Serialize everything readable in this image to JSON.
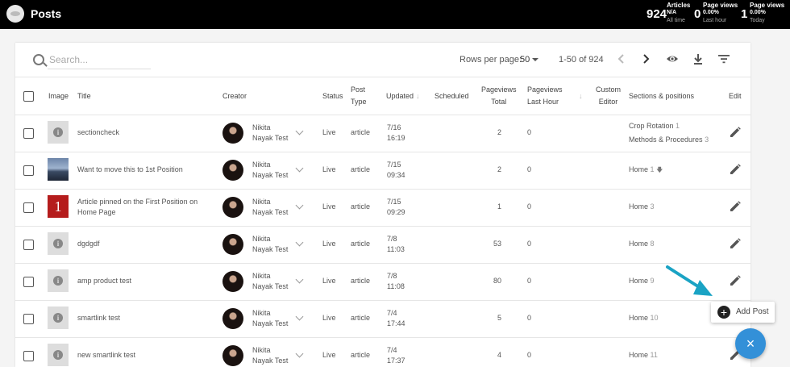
{
  "app": {
    "title": "Posts"
  },
  "stats": {
    "articles": {
      "label": "Articles",
      "value": "924",
      "sub_value": "N/A",
      "sub_label": "All time"
    },
    "pv_hour": {
      "label": "Page views",
      "value": "0",
      "sub_value": "0.00%",
      "sub_label": "Last hour"
    },
    "pv_today": {
      "label": "Page views",
      "value": "1",
      "sub_value": "0.00%",
      "sub_label": "Today"
    }
  },
  "toolbar": {
    "search_placeholder": "Search...",
    "rows_per_page_label": "Rows per page:",
    "rows_per_page_value": "50",
    "range": "1-50 of 924"
  },
  "columns": {
    "image": "Image",
    "title": "Title",
    "creator": "Creator",
    "status": "Status",
    "post_type_1": "Post",
    "post_type_2": "Type",
    "updated": "Updated",
    "scheduled": "Scheduled",
    "pv_total_1": "Pageviews",
    "pv_total_2": "Total",
    "pv_hour_1": "Pageviews",
    "pv_hour_2": "Last Hour",
    "custom_1": "Custom",
    "custom_2": "Editor",
    "sections": "Sections & positions",
    "edit": "Edit"
  },
  "rows": [
    {
      "title": "sectioncheck",
      "creator": "Nikita Nayak Test",
      "status": "Live",
      "type": "article",
      "updated_date": "7/16",
      "updated_time": "16:19",
      "pv_total": "2",
      "pv_hour": "0",
      "sections": [
        {
          "name": "Crop Rotation",
          "pos": "1"
        },
        {
          "name": "Methods & Procedures",
          "pos": "3"
        }
      ]
    },
    {
      "title": "Want to move this to 1st Position",
      "creator": "Nikita Nayak Test",
      "status": "Live",
      "type": "article",
      "updated_date": "7/15",
      "updated_time": "09:34",
      "pv_total": "2",
      "pv_hour": "0",
      "sections": [
        {
          "name": "Home",
          "pos": "1"
        }
      ]
    },
    {
      "title": "Article pinned on the First Position on Home Page",
      "creator": "Nikita Nayak Test",
      "status": "Live",
      "type": "article",
      "updated_date": "7/15",
      "updated_time": "09:29",
      "pv_total": "1",
      "pv_hour": "0",
      "thumb_text": "1",
      "sections": [
        {
          "name": "Home",
          "pos": "3"
        }
      ]
    },
    {
      "title": "dgdgdf",
      "creator": "Nikita Nayak Test",
      "status": "Live",
      "type": "article",
      "updated_date": "7/8",
      "updated_time": "11:03",
      "pv_total": "53",
      "pv_hour": "0",
      "sections": [
        {
          "name": "Home",
          "pos": "8"
        }
      ]
    },
    {
      "title": "amp product test",
      "creator": "Nikita Nayak Test",
      "status": "Live",
      "type": "article",
      "updated_date": "7/8",
      "updated_time": "11:08",
      "pv_total": "80",
      "pv_hour": "0",
      "sections": [
        {
          "name": "Home",
          "pos": "9"
        }
      ]
    },
    {
      "title": "smartlink test",
      "creator": "Nikita Nayak Test",
      "status": "Live",
      "type": "article",
      "updated_date": "7/4",
      "updated_time": "17:44",
      "pv_total": "5",
      "pv_hour": "0",
      "sections": [
        {
          "name": "Home",
          "pos": "10"
        }
      ]
    },
    {
      "title": "new smartlink test",
      "creator": "Nikita Nayak Test",
      "status": "Live",
      "type": "article",
      "updated_date": "7/4",
      "updated_time": "17:37",
      "pv_total": "4",
      "pv_hour": "0",
      "sections": [
        {
          "name": "Home",
          "pos": "11"
        }
      ]
    }
  ],
  "add_post": {
    "label": "Add Post",
    "plus": "+"
  },
  "fab": {
    "label": "×"
  },
  "icons": [
    "search-icon",
    "chevron-left-icon",
    "chevron-right-icon",
    "eye-icon",
    "download-icon",
    "filter-icon",
    "pencil-icon",
    "info-icon",
    "pin-icon",
    "plus-icon",
    "close-icon",
    "arrow-icon"
  ],
  "colors": {
    "topbar": "#000000",
    "fab": "#3390d8",
    "arrow": "#1aa3c4"
  }
}
